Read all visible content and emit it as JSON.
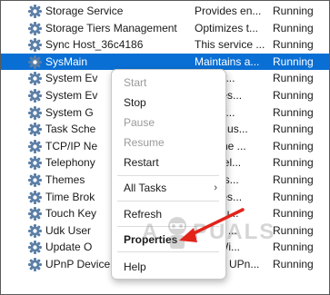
{
  "services": [
    {
      "name": "Storage Service",
      "description": "Provides en...",
      "status": "Running"
    },
    {
      "name": "Storage Tiers Management",
      "description": "Optimizes t...",
      "status": "Running"
    },
    {
      "name": "Sync Host_36c4186",
      "description": "This service ...",
      "status": "Running"
    },
    {
      "name": "SysMain",
      "description": "Maintains a...",
      "status": "Running"
    },
    {
      "name": "System Ev",
      "description": "...rs sy...",
      "status": "Running"
    },
    {
      "name": "System Ev",
      "description": "...inates...",
      "status": "Running"
    },
    {
      "name": "System G",
      "description": "...rs sy...",
      "status": "Running"
    },
    {
      "name": "Task Sche",
      "description": "...es a us...",
      "status": "Running"
    },
    {
      "name": "TCP/IP Ne",
      "description": "...rts the ...",
      "status": "Running"
    },
    {
      "name": "Telephony",
      "description": "...es Tel...",
      "status": "Running"
    },
    {
      "name": "Themes",
      "description": "...es us...",
      "status": "Running"
    },
    {
      "name": "Time Brok",
      "description": "...inates...",
      "status": "Running"
    },
    {
      "name": "Touch Key",
      "description": "...s Tou...",
      "status": "Running"
    },
    {
      "name": "Udk User",
      "description": "...nent ...",
      "status": "Running"
    },
    {
      "name": "Update O",
      "description": "...es Wi...",
      "status": "Running"
    },
    {
      "name": "UPnP Device Host",
      "description": "Allows UPn...",
      "status": "Running"
    }
  ],
  "selected_row": "SysMain",
  "context_menu": {
    "start": "Start",
    "stop": "Stop",
    "pause": "Pause",
    "resume": "Resume",
    "restart": "Restart",
    "all_tasks": "All Tasks",
    "all_tasks_arrow": "›",
    "refresh": "Refresh",
    "properties": "Properties",
    "help": "Help"
  },
  "watermark": {
    "text_left": "A",
    "text_right": "PUALS"
  },
  "colors": {
    "selection": "#0a6fd4",
    "annotation_arrow": "#e2231a",
    "gear": "#5b7ea6"
  },
  "icons": {
    "service": "gear-icon"
  }
}
